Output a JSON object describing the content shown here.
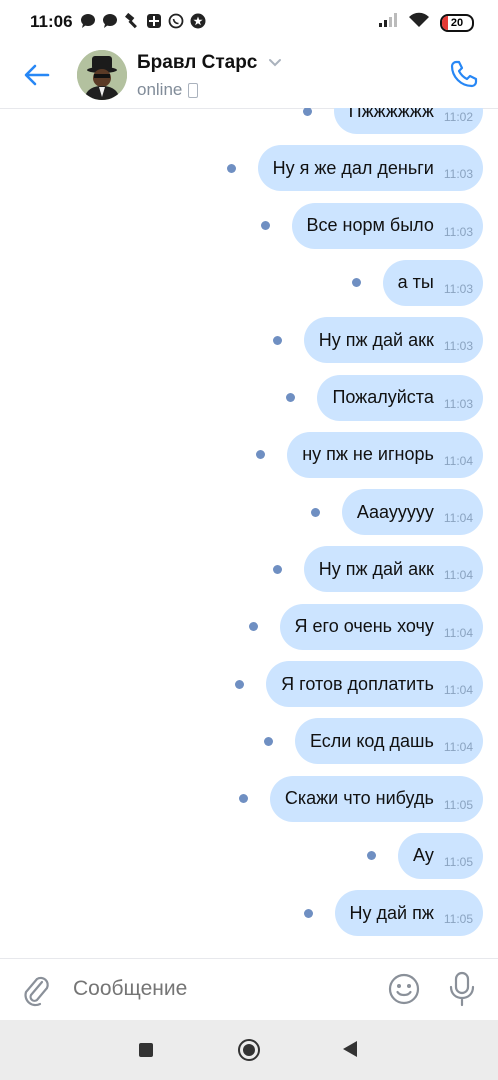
{
  "status_bar": {
    "time": "11:06",
    "battery": "20",
    "left_icons": [
      "chat-bubble-icon",
      "chat-bubble-icon",
      "hammer-icon",
      "puzzle-icon",
      "whatsapp-icon",
      "star-icon"
    ],
    "right_icons": [
      "signal-icon",
      "wifi-icon",
      "battery-icon"
    ]
  },
  "header": {
    "title": "Бравл Старс",
    "status": "online",
    "accent_color": "#2787f5"
  },
  "messages": [
    {
      "text": "Пжжжжжж",
      "time": "11:02"
    },
    {
      "text": "Ну я же дал деньги",
      "time": "11:03"
    },
    {
      "text": "Все норм было",
      "time": "11:03"
    },
    {
      "text": "а ты",
      "time": "11:03"
    },
    {
      "text": "Ну пж дай акк",
      "time": "11:03"
    },
    {
      "text": "Пожалуйста",
      "time": "11:03"
    },
    {
      "text": "ну пж не игнорь",
      "time": "11:04"
    },
    {
      "text": "Аааууууу",
      "time": "11:04"
    },
    {
      "text": "Ну пж дай акк",
      "time": "11:04"
    },
    {
      "text": "Я его очень хочу",
      "time": "11:04"
    },
    {
      "text": "Я готов доплатить",
      "time": "11:04"
    },
    {
      "text": "Если код дашь",
      "time": "11:04"
    },
    {
      "text": "Скажи что нибудь",
      "time": "11:05"
    },
    {
      "text": "Ау",
      "time": "11:05"
    },
    {
      "text": "Ну дай пж",
      "time": "11:05"
    }
  ],
  "composer": {
    "placeholder": "Сообщение"
  },
  "colors": {
    "bubble": "#cce4ff",
    "unread_dot": "#6f8fc2",
    "accent": "#2787f5"
  }
}
